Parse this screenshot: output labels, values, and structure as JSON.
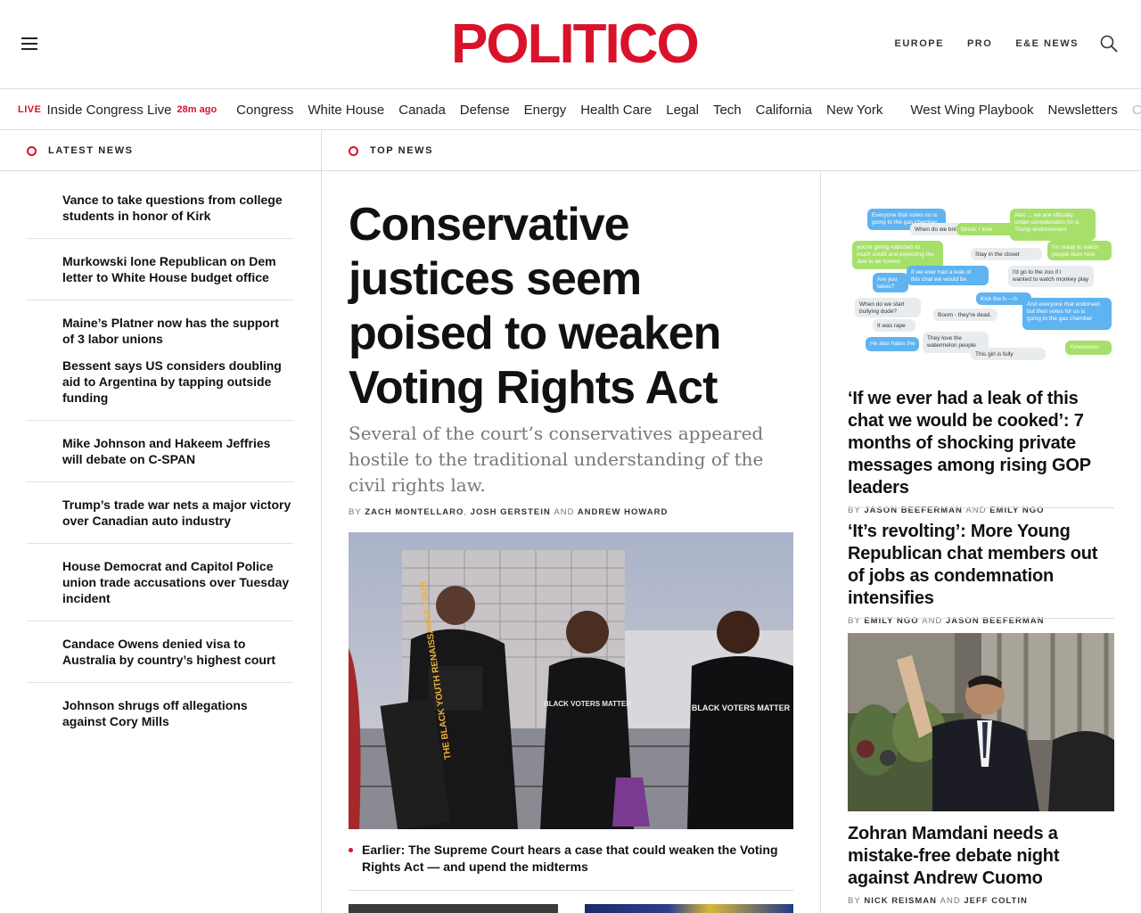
{
  "header": {
    "logo": "POLITICO",
    "nav": [
      "EUROPE",
      "PRO",
      "E&E NEWS"
    ]
  },
  "sectionNav": {
    "live": {
      "tag": "LIVE",
      "title": "Inside Congress Live",
      "time": "28m ago"
    },
    "items": [
      "Congress",
      "White House",
      "Canada",
      "Defense",
      "Energy",
      "Health Care",
      "Legal",
      "Tech",
      "California",
      "New York"
    ],
    "items2": [
      "West Wing Playbook",
      "Newsletters",
      "C"
    ]
  },
  "latestNews": {
    "heading": "LATEST NEWS",
    "items": [
      "Vance to take questions from college students in honor of Kirk",
      "Murkowski lone Republican on Dem letter to White House budget office",
      "Maine’s Platner now has the support of 3 labor unions",
      "Bessent says US considers doubling aid to Argentina by tapping outside funding",
      "Mike Johnson and Hakeem Jeffries will debate on C-SPAN",
      "Trump’s trade war nets a major victory over Canadian auto industry",
      "House Democrat and Capitol Police union trade accusations over Tuesday incident",
      "Candace Owens denied visa to Australia by country’s highest court",
      "Johnson shrugs off allegations against Cory Mills"
    ]
  },
  "topNews": {
    "heading": "TOP NEWS",
    "lead": {
      "headline": "Conservative justices seem poised to weaken Voting Rights Act",
      "dek": "Several of the court’s conservatives appeared hostile to the traditional understanding of the civil rights law.",
      "by": "BY",
      "authors": [
        "ZACH MONTELLARO",
        "JOSH GERSTEIN",
        "ANDREW HOWARD"
      ],
      "comma": ",",
      "and": "AND",
      "related": "Earlier: The Supreme Court hears a case that could weaken the Voting Rights Act — and upend the midterms"
    }
  },
  "rightColumn": {
    "stories": [
      {
        "headline": "‘If we ever had a leak of this chat we would be cooked’: 7 months of shocking private messages among rising GOP leaders",
        "author1": "JASON BEEFERMAN",
        "author2": "EMILY NGO"
      },
      {
        "headline": "‘It’s revolting’: More Young Republican chat members out of jobs as condemnation intensifies",
        "author1": "EMILY NGO",
        "author2": "JASON BEEFERMAN"
      },
      {
        "headline": "Zohran Mamdani needs a mistake-free debate night against Andrew Cuomo",
        "author1": "NICK REISMAN",
        "author2": "JEFF COLTIN"
      }
    ],
    "by": "BY",
    "and": "AND",
    "chatBubbles": [
      "Everyone that votes no is going to the gas chamber",
      "Also ... we are officially under consideration for a Trump endorsement",
      "When do we bring it",
      "Great. I love Hitler",
      "you're giving nationals to much credit and expecting the Jew to be honest",
      "Stay in the closet f----t",
      "I'm ready to watch people burn now",
      "Are you takes?",
      "If we ever had a leak of this chat we would be cooked fr fr",
      "I'd go to the zoo if I wanted to watch monkey play ball",
      "Kick the b----h",
      "When do we start bullying dude?",
      "Boom - they're dead.",
      "And everyone that endorsed but then votes for us is going to the gas chamber",
      "It was rape",
      "He also hates the",
      "They love the watermelon people",
      "This girl is fully r-----d",
      "Yoooooooo"
    ]
  },
  "imageText": {
    "signTour": "THE BLACK YOUTH RENAISSANCE TOUR",
    "shirt": "BLACK VOTERS MATTER"
  },
  "colors": {
    "brand": "#d9122a",
    "text": "#111111",
    "muted": "#777777",
    "rule": "#dddddd"
  }
}
